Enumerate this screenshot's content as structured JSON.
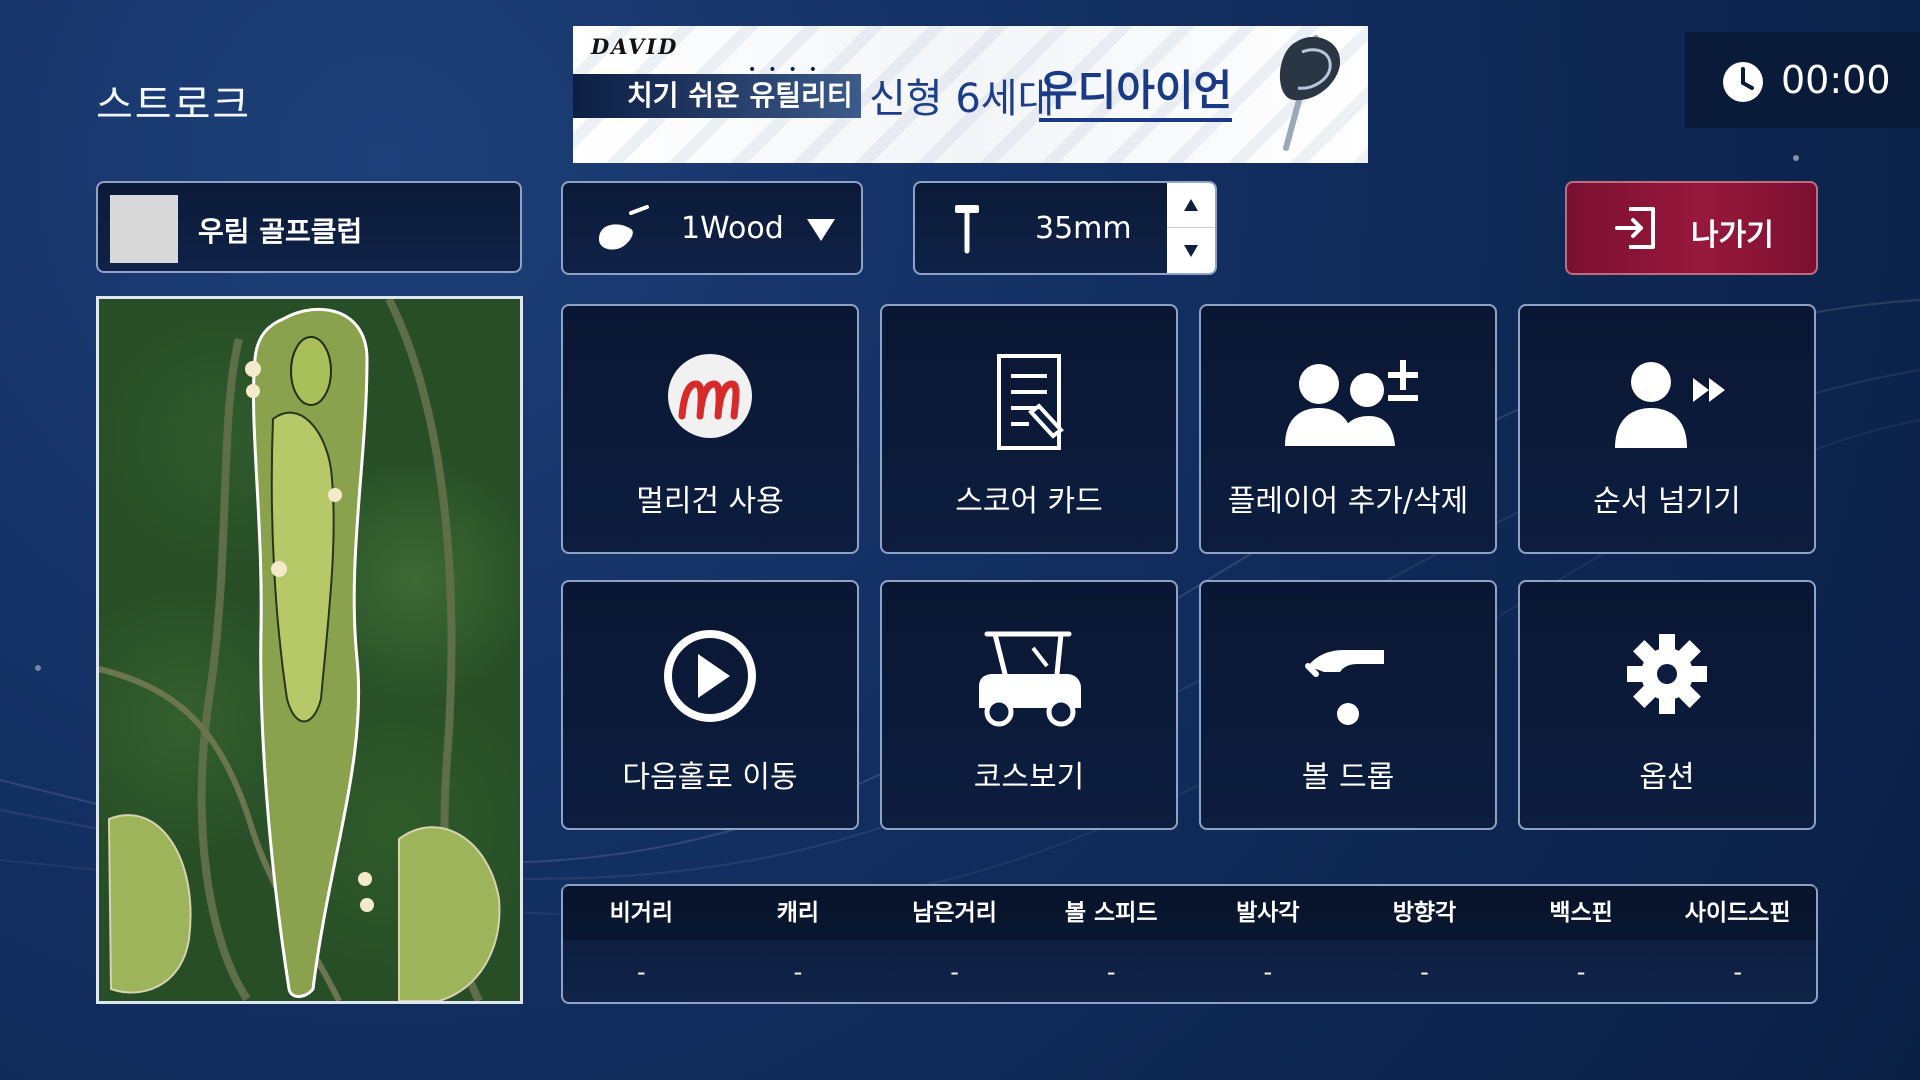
{
  "header": {
    "title": "스트로크"
  },
  "banner": {
    "brand": "DAVID",
    "tag": "치기 쉬운 유틸리티",
    "text": "신형 6세대",
    "highlight": "우디아이언"
  },
  "timer": {
    "icon": "clock-icon",
    "value": "00:00"
  },
  "club": {
    "name": "우림 골프클럽"
  },
  "club_selector": {
    "icon": "golf-club-icon",
    "value": "1Wood"
  },
  "tee_height": {
    "icon": "tee-icon",
    "value": "35mm"
  },
  "exit": {
    "icon": "exit-icon",
    "label": "나가기"
  },
  "tiles": [
    {
      "label": "멀리건 사용",
      "icon": "mulligan-icon"
    },
    {
      "label": "스코어 카드",
      "icon": "scorecard-icon"
    },
    {
      "label": "플레이어 추가/삭제",
      "icon": "add-remove-player-icon"
    },
    {
      "label": "순서 넘기기",
      "icon": "skip-turn-icon"
    },
    {
      "label": "다음홀로 이동",
      "icon": "play-icon"
    },
    {
      "label": "코스보기",
      "icon": "golf-cart-icon"
    },
    {
      "label": "볼 드롭",
      "icon": "ball-drop-icon"
    },
    {
      "label": "옵션",
      "icon": "gear-icon"
    }
  ],
  "stats": {
    "headers": [
      "비거리",
      "캐리",
      "남은거리",
      "볼 스피드",
      "발사각",
      "방향각",
      "백스핀",
      "사이드스핀"
    ],
    "values": [
      "-",
      "-",
      "-",
      "-",
      "-",
      "-",
      "-",
      "-"
    ]
  },
  "colors": {
    "background": "#133063",
    "panel_border": "#8ea2c6",
    "exit_button": "#98183d",
    "banner_blue": "#1a3a85"
  }
}
